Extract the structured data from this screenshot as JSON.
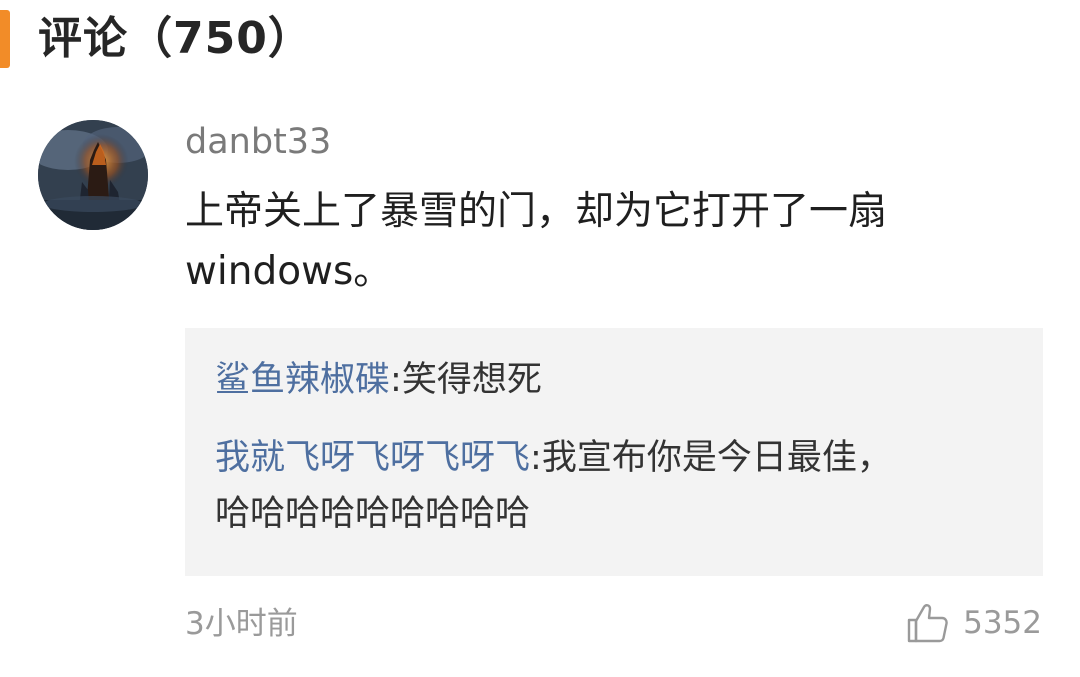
{
  "header": {
    "title": "评论（750）"
  },
  "comment": {
    "avatar_icon": "avatar-fantasy-tower",
    "username": "danbt33",
    "text_lines": [
      "上帝关上了暴雪的门，却为它打开了一扇",
      "windows。"
    ],
    "replies": [
      {
        "author": "鲨鱼辣椒碟",
        "separator": ":",
        "lines": [
          "笑得想死"
        ]
      },
      {
        "author": "我就飞呀飞呀飞呀飞",
        "separator": ":",
        "lines": [
          "我宣布你是今日最佳，",
          "哈哈哈哈哈哈哈哈哈"
        ]
      }
    ],
    "timestamp": "3小时前",
    "like_icon": "thumbs-up-icon",
    "like_count": "5352"
  },
  "colors": {
    "accent": "#f28c28",
    "reply_author": "#4e6fa0",
    "muted_text": "#9a9a9a",
    "reply_background": "#f3f3f3"
  }
}
